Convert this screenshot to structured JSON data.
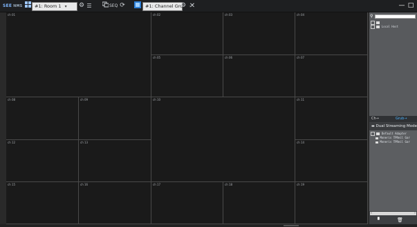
{
  "toolbar": {
    "logo_text": "SEE",
    "logo_sub": "NMS",
    "room_icon": "room-grid-icon",
    "room_select_value": "#1: Room 1",
    "settings_icon": "gear-icon",
    "list_icon": "list-icon",
    "seq_label": "SEQ",
    "seq_icon": "sequence-icon",
    "refresh_icon": "refresh-icon",
    "channel_group_icon": "channel-group-icon",
    "channel_group_value": "#1: Channel Grou",
    "channel_settings_icon": "gear-icon",
    "close_layout_icon": "close-icon",
    "minimize": "—",
    "maximize": "□"
  },
  "grid": {
    "cells": [
      {
        "label": "ch 01"
      },
      {
        "label": "ch 02"
      },
      {
        "label": "ch 03"
      },
      {
        "label": "ch 04"
      },
      {
        "label": "ch 05"
      },
      {
        "label": "ch 06"
      },
      {
        "label": "ch 07"
      },
      {
        "label": "ch 08"
      },
      {
        "label": "ch 09"
      },
      {
        "label": "ch 10"
      },
      {
        "label": "ch 11"
      },
      {
        "label": "ch 12"
      },
      {
        "label": "ch 13"
      },
      {
        "label": "ch 14"
      },
      {
        "label": "ch 15"
      },
      {
        "label": "ch 16"
      },
      {
        "label": "ch 17"
      },
      {
        "label": "ch 18"
      },
      {
        "label": "ch 19"
      }
    ]
  },
  "sidebar": {
    "tree": [
      {
        "text": "Local Host"
      }
    ],
    "tab_left": "Ch→",
    "tab_right": "Grub→",
    "mode_label": "Dual Streaming Mode",
    "list_rows": [
      {
        "text": "Default Adapter"
      },
      {
        "text": "Moneris TPReil Gar"
      },
      {
        "text": "Moneris TPReil Gar"
      }
    ]
  },
  "colors": {
    "accent": "#4ab3ff",
    "toolbar_bg": "#1e1f21",
    "cell_border": "#4a4a4a"
  }
}
